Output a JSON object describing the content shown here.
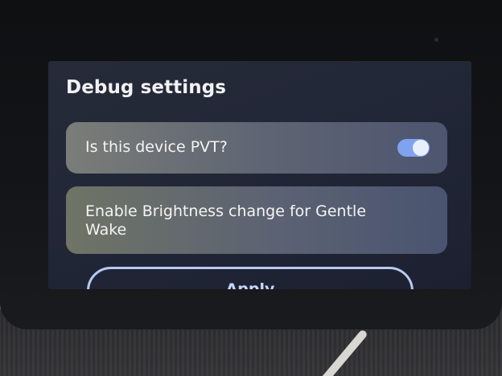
{
  "screen": {
    "title": "Debug settings"
  },
  "settings": [
    {
      "label": "Is this device PVT?",
      "toggle_state": "on"
    },
    {
      "label": "Enable Brightness change for Gentle Wake"
    }
  ],
  "actions": {
    "apply_label": "Apply"
  },
  "colors": {
    "accent": "#7fa3f0",
    "card_background": "#5f6573",
    "screen_background": "#222737"
  }
}
